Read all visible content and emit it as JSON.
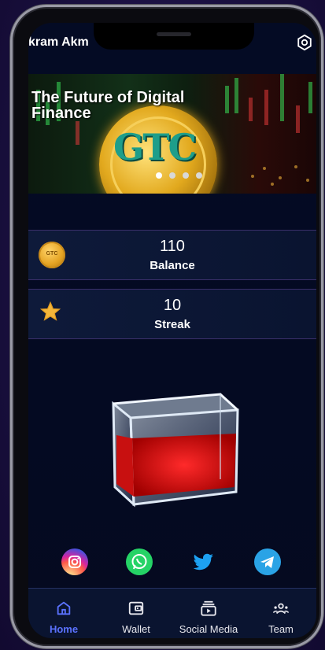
{
  "header": {
    "username": "kram Akm",
    "settings_icon": "settings-hex-icon"
  },
  "banner": {
    "title": "The Future of Digital Finance",
    "coin_text": "GTC",
    "carousel_dots": 4,
    "active_dot": 0
  },
  "stats": [
    {
      "icon": "gtc-coin-icon",
      "value": "110",
      "label": "Balance"
    },
    {
      "icon": "star-icon",
      "value": "10",
      "label": "Streak"
    }
  ],
  "socials": [
    {
      "name": "instagram-icon",
      "color": "#d6249f"
    },
    {
      "name": "whatsapp-icon",
      "color": "#25d366"
    },
    {
      "name": "twitter-icon",
      "color": "#1da1f2"
    },
    {
      "name": "telegram-icon",
      "color": "#2aa3e6"
    }
  ],
  "nav": {
    "items": [
      {
        "label": "Home",
        "icon": "home-icon",
        "active": true
      },
      {
        "label": "Wallet",
        "icon": "wallet-icon",
        "active": false
      },
      {
        "label": "Social Media",
        "icon": "video-library-icon",
        "active": false
      },
      {
        "label": "Team",
        "icon": "team-icon",
        "active": false
      }
    ]
  },
  "colors": {
    "accent": "#5b72ff",
    "background": "#040b24",
    "card_border": "#3a2f6a"
  }
}
